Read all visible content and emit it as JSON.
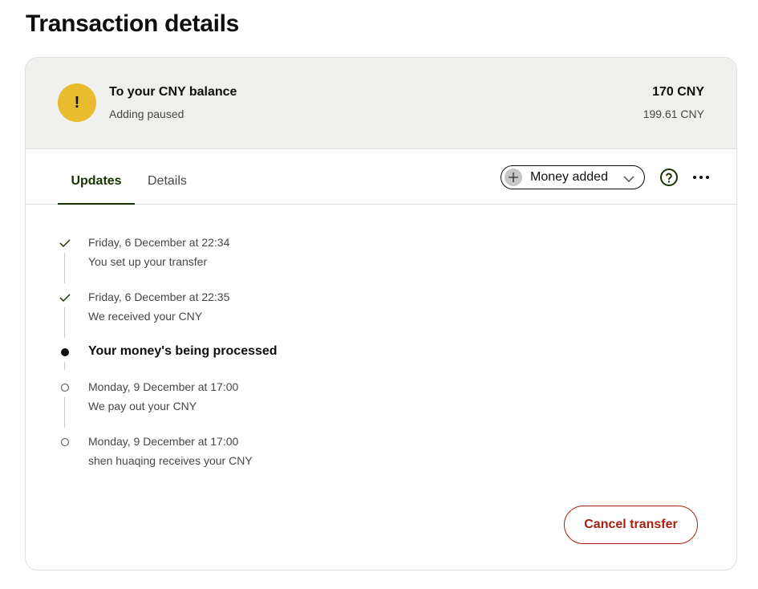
{
  "page": {
    "title": "Transaction details"
  },
  "summary": {
    "icon": "warning-exclamation-icon",
    "icon_glyph": "!",
    "title": "To your CNY balance",
    "status": "Adding paused",
    "amount_main": "170 CNY",
    "amount_sub": "199.61 CNY",
    "accent_color": "#e8bc2e"
  },
  "tabs": [
    {
      "label": "Updates",
      "active": true
    },
    {
      "label": "Details",
      "active": false
    }
  ],
  "filter": {
    "label": "Money added",
    "icon": "plus-icon"
  },
  "actions": {
    "help_icon": "help-circle-icon",
    "more_icon": "more-dots-icon"
  },
  "timeline": [
    {
      "state": "done",
      "date": "Friday, 6 December at 22:34",
      "text": "You set up your transfer"
    },
    {
      "state": "done",
      "date": "Friday, 6 December at 22:35",
      "text": "We received your CNY"
    },
    {
      "state": "current",
      "text": "Your money's being processed"
    },
    {
      "state": "pending",
      "date": "Monday, 9 December at 17:00",
      "text": "We pay out your CNY"
    },
    {
      "state": "pending",
      "date": "Monday, 9 December at 17:00",
      "text": "shen huaqing receives your CNY"
    }
  ],
  "cancel_label": "Cancel transfer",
  "colors": {
    "brand_dark": "#163300",
    "danger": "#a8200d",
    "summary_bg": "#eff0ee"
  }
}
